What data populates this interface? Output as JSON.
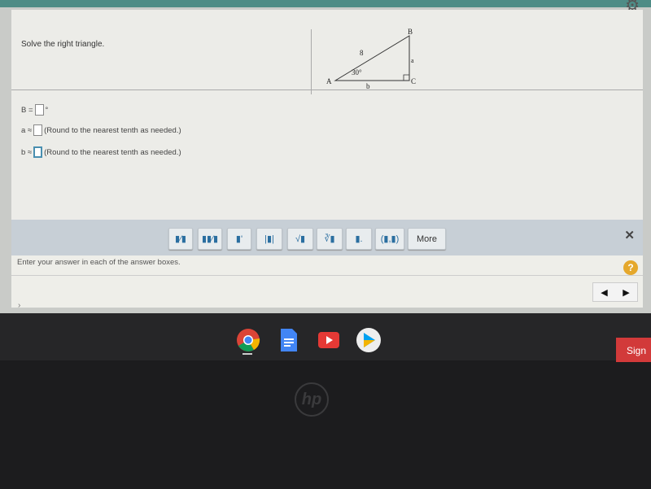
{
  "question": {
    "prompt": "Solve the right triangle.",
    "figure": {
      "vertex_a": "A",
      "vertex_b": "B",
      "vertex_c": "C",
      "hypotenuse": "8",
      "angle": "30°",
      "side_a": "a",
      "side_b": "b"
    }
  },
  "answers": [
    {
      "label": "B =",
      "unit": "°",
      "value": "",
      "hint": ""
    },
    {
      "label": "a ≈",
      "unit": "",
      "value": "",
      "hint": "(Round to the nearest tenth as needed.)"
    },
    {
      "label": "b ≈",
      "unit": "",
      "value": "",
      "hint": "(Round to the nearest tenth as needed.)"
    }
  ],
  "toolbar": {
    "buttons": [
      {
        "icon": "fraction-icon",
        "glyph": "▮⁄▮"
      },
      {
        "icon": "mixed-number-icon",
        "glyph": "▮▮⁄▮"
      },
      {
        "icon": "exponent-icon",
        "glyph": "▮'"
      },
      {
        "icon": "absolute-value-icon",
        "glyph": "|▮|"
      },
      {
        "icon": "square-root-icon",
        "glyph": "√▮"
      },
      {
        "icon": "nth-root-icon",
        "glyph": "∛▮"
      },
      {
        "icon": "decimal-icon",
        "glyph": "▮."
      },
      {
        "icon": "ordered-pair-icon",
        "glyph": "(▮,▮)"
      }
    ],
    "more_label": "More",
    "close": "✕"
  },
  "help": {
    "text": "Enter your answer in each of the answer boxes.",
    "help_symbol": "?",
    "prev": "◀",
    "next": "▶"
  },
  "shelf": {
    "apps": [
      "chrome-icon",
      "docs-icon",
      "youtube-icon",
      "play-store-icon"
    ],
    "sign_in": "Sign"
  },
  "bezel": {
    "logo": "hp"
  }
}
